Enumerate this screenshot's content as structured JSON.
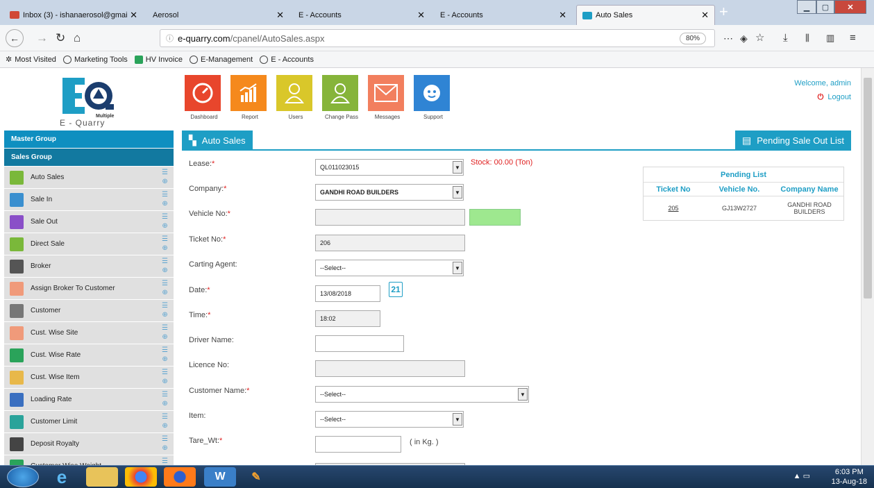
{
  "browser": {
    "tabs": [
      {
        "title": "Inbox (3) - ishanaerosol@gmai",
        "icon": "gmail-icon",
        "icon_color": "#d14836"
      },
      {
        "title": "Aerosol",
        "icon": "",
        "icon_color": ""
      },
      {
        "title": "E - Accounts",
        "icon": "",
        "icon_color": ""
      },
      {
        "title": "E - Accounts",
        "icon": "",
        "icon_color": ""
      },
      {
        "title": "Auto Sales",
        "icon": "eq-favicon",
        "icon_color": "#1e9ec5"
      }
    ],
    "url_host": "e-quarry.com",
    "url_path": "/cpanel/AutoSales.aspx",
    "zoom": "80%",
    "bookmarks": [
      "Most Visited",
      "Marketing Tools",
      "HV Invoice",
      "E-Management",
      "E - Accounts"
    ]
  },
  "header": {
    "brand": "E - Quarry",
    "brand_small": "Multiple",
    "welcome": "Welcome, admin",
    "logout": "Logout",
    "tiles": [
      {
        "label": "Dashboard",
        "color": "#e8462c",
        "icon": "speedometer-icon",
        "glyph": "◔"
      },
      {
        "label": "Report",
        "color": "#f5891c",
        "icon": "bar-chart-icon",
        "glyph": "▟"
      },
      {
        "label": "Users",
        "color": "#d9c72a",
        "icon": "user-icon",
        "glyph": "♙"
      },
      {
        "label": "Change Pass",
        "color": "#86b43a",
        "icon": "user-outline-icon",
        "glyph": "♙"
      },
      {
        "label": "Messages",
        "color": "#f27f5e",
        "icon": "envelope-icon",
        "glyph": "✉"
      },
      {
        "label": "Support",
        "color": "#2f84d4",
        "icon": "support-agent-icon",
        "glyph": "☺"
      }
    ]
  },
  "sidebar": {
    "master_group": "Master Group",
    "sales_group": "Sales Group",
    "items": [
      {
        "label": "Auto Sales",
        "color": "#7ab83a"
      },
      {
        "label": "Sale In",
        "color": "#3a8fcf"
      },
      {
        "label": "Sale Out",
        "color": "#8a4fc8"
      },
      {
        "label": "Direct Sale",
        "color": "#7ab83a"
      },
      {
        "label": "Broker",
        "color": "#555555"
      },
      {
        "label": "Assign Broker To Customer",
        "color": "#f09a7a"
      },
      {
        "label": "Customer",
        "color": "#777777"
      },
      {
        "label": "Cust. Wise Site",
        "color": "#f09a7a"
      },
      {
        "label": "Cust. Wise Rate",
        "color": "#2aa35a"
      },
      {
        "label": "Cust. Wise Item",
        "color": "#e8b84a"
      },
      {
        "label": "Loading Rate",
        "color": "#3a6fc0"
      },
      {
        "label": "Customer Limit",
        "color": "#2aa39a"
      },
      {
        "label": "Deposit Royalty",
        "color": "#444444"
      },
      {
        "label": "Customer Wise Weight",
        "color": "#2aa35a"
      }
    ]
  },
  "content": {
    "tab_label": "Auto Sales",
    "pending_button": "Pending Sale Out List",
    "stock": "Stock: 00.00 (Ton)",
    "fields": {
      "lease": {
        "label": "Lease:",
        "value": "QL011023015"
      },
      "company": {
        "label": "Company:",
        "value": "GANDHI ROAD BUILDERS"
      },
      "vehicle": {
        "label": "Vehicle No:",
        "value": ""
      },
      "ticket": {
        "label": "Ticket No:",
        "value": "206"
      },
      "carting": {
        "label": "Carting Agent:",
        "value": "--Select--"
      },
      "date": {
        "label": "Date:",
        "value": "13/08/2018"
      },
      "time": {
        "label": "Time:",
        "value": "18:02"
      },
      "driver": {
        "label": "Driver Name:",
        "value": ""
      },
      "licence": {
        "label": "Licence No:",
        "value": ""
      },
      "customer": {
        "label": "Customer Name:",
        "value": "--Select--"
      },
      "item": {
        "label": "Item:",
        "value": "--Select--"
      },
      "tare": {
        "label": "Tare_Wt:",
        "value": "",
        "unit": "( in Kg. )"
      }
    },
    "req_mark": "*",
    "calendar_day": "21"
  },
  "pending_list": {
    "title": "Pending List",
    "columns": [
      "Ticket No",
      "Vehicle No.",
      "Company Name"
    ],
    "rows": [
      {
        "ticket": "205",
        "vehicle": "GJ13W2727",
        "company": "GANDHI ROAD BUILDERS"
      }
    ]
  },
  "taskbar": {
    "time": "6:03 PM",
    "date": "13-Aug-18"
  }
}
